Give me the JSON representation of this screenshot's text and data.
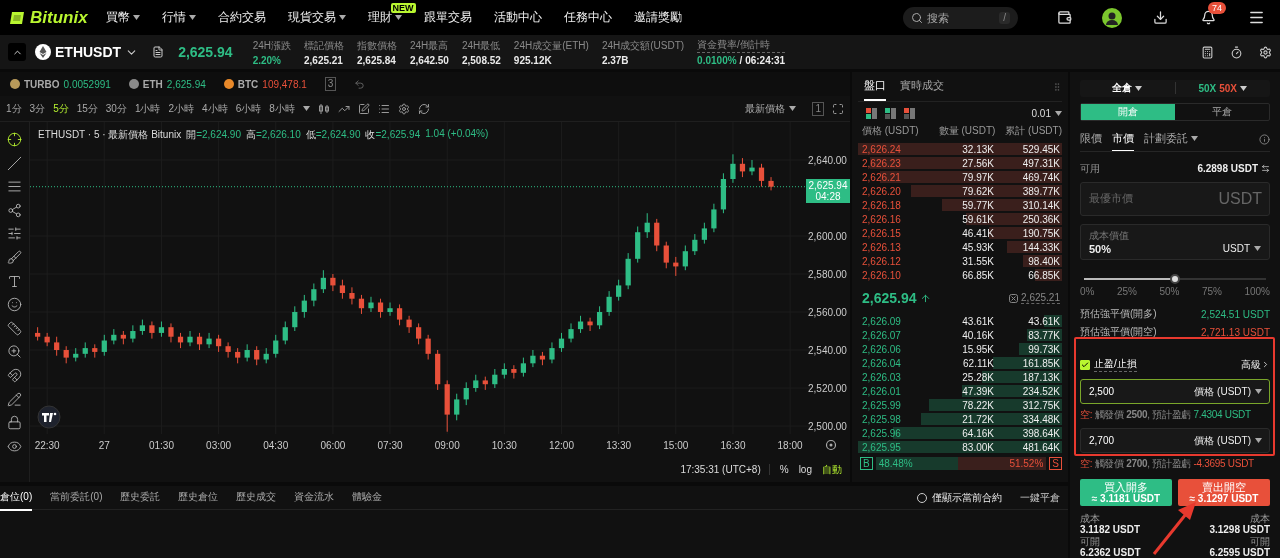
{
  "nav": {
    "logo": "Bitunix",
    "items": [
      {
        "label": "買幣",
        "dropdown": true
      },
      {
        "label": "行情",
        "dropdown": true
      },
      {
        "label": "合約交易",
        "dropdown": false
      },
      {
        "label": "現貨交易",
        "dropdown": true
      },
      {
        "label": "理財",
        "dropdown": true,
        "badge": "NEW"
      },
      {
        "label": "跟單交易",
        "dropdown": false
      },
      {
        "label": "活動中心",
        "dropdown": false
      },
      {
        "label": "任務中心",
        "dropdown": false
      },
      {
        "label": "邀請獎勵",
        "dropdown": false
      }
    ],
    "search": {
      "placeholder": "搜索",
      "shortcut": "/"
    },
    "notifications": "74"
  },
  "ticker": {
    "symbol": "ETHUSDT",
    "price": "2,625.94",
    "stats": [
      {
        "label": "24H漲跌",
        "value": "2.20%",
        "kind": "up"
      },
      {
        "label": "標記價格",
        "value": "2,625.21",
        "kind": "plain"
      },
      {
        "label": "指數價格",
        "value": "2,625.84",
        "kind": "plain"
      },
      {
        "label": "24H最高",
        "value": "2,642.50",
        "kind": "plain"
      },
      {
        "label": "24H最低",
        "value": "2,508.52",
        "kind": "plain"
      },
      {
        "label": "24H成交量(ETH)",
        "value": "925.12K",
        "kind": "plain"
      },
      {
        "label": "24H成交額(USDT)",
        "value": "2.37B",
        "kind": "plain"
      }
    ],
    "funding": {
      "label": "資金費率/倒計時",
      "rate": "0.0100%",
      "countdown": "/ 06:24:31"
    }
  },
  "watchlist": {
    "items": [
      {
        "symbol": "TURBO",
        "price": "0.0052991",
        "kind": "up",
        "color": "#b89a5a"
      },
      {
        "symbol": "ETH",
        "price": "2,625.94",
        "kind": "up",
        "color": "#8a8a8a"
      },
      {
        "symbol": "BTC",
        "price": "109,478.1",
        "kind": "down",
        "color": "#e8892a"
      }
    ],
    "layout_label": "3"
  },
  "chart": {
    "intervals": [
      {
        "label": "1分",
        "selected": false
      },
      {
        "label": "3分",
        "selected": false
      },
      {
        "label": "5分",
        "selected": true
      },
      {
        "label": "15分",
        "selected": false
      },
      {
        "label": "30分",
        "selected": false
      },
      {
        "label": "1小時",
        "selected": false
      },
      {
        "label": "2小時",
        "selected": false
      },
      {
        "label": "4小時",
        "selected": false
      },
      {
        "label": "6小時",
        "selected": false
      },
      {
        "label": "8小時",
        "selected": false
      }
    ],
    "price_type": "最新價格",
    "layout_label": "1",
    "legend": {
      "title": "ETHUSDT · 5 · 最新價格 Bitunix",
      "fields": [
        {
          "label": "開",
          "value": "=2,624.90"
        },
        {
          "label": "高",
          "value": "=2,626.10"
        },
        {
          "label": "低",
          "value": "=2,624.90"
        },
        {
          "label": "收",
          "value": "=2,625.94"
        }
      ],
      "change": "1.04 (+0.04%)"
    },
    "last_price": "2,625.94",
    "countdown": "04:28",
    "chart_data": {
      "type": "candlestick",
      "ylim": [
        2495.8,
        2660
      ],
      "grid": true,
      "ref_lines": [
        {
          "axis": "y",
          "value": 2625.94
        }
      ],
      "yticks": [
        {
          "value": 2640,
          "label": "2,640.00"
        },
        {
          "value": 2600,
          "label": "2,600.00"
        },
        {
          "value": 2580,
          "label": "2,580.00"
        },
        {
          "value": 2560,
          "label": "2,560.00"
        },
        {
          "value": 2540,
          "label": "2,540.00"
        },
        {
          "value": 2520,
          "label": "2,520.00"
        },
        {
          "value": 2500,
          "label": "2,500.00"
        }
      ],
      "categories": [
        null,
        "22:30",
        null,
        null,
        null,
        null,
        null,
        "27",
        null,
        null,
        null,
        null,
        null,
        "01:30",
        null,
        null,
        null,
        null,
        null,
        "03:00",
        null,
        null,
        null,
        null,
        null,
        "04:30",
        null,
        null,
        null,
        null,
        null,
        "06:00",
        null,
        null,
        null,
        null,
        null,
        "07:30",
        null,
        null,
        null,
        null,
        null,
        "09:00",
        null,
        null,
        null,
        null,
        null,
        "10:30",
        null,
        null,
        null,
        null,
        null,
        "12:00",
        null,
        null,
        null,
        null,
        null,
        "13:30",
        null,
        null,
        null,
        null,
        null,
        "15:00",
        null,
        null,
        null,
        null,
        null,
        "16:30",
        null,
        null,
        null,
        null,
        null,
        "18:00"
      ],
      "ohlc": [
        [
          2549,
          2552,
          2545,
          2547
        ],
        [
          2547,
          2549,
          2542,
          2544
        ],
        [
          2544,
          2547,
          2537,
          2540
        ],
        [
          2540,
          2542,
          2533,
          2536
        ],
        [
          2536,
          2541,
          2534,
          2538
        ],
        [
          2538,
          2544,
          2536,
          2541
        ],
        [
          2541,
          2543,
          2536,
          2539
        ],
        [
          2539,
          2548,
          2537,
          2545
        ],
        [
          2545,
          2551,
          2543,
          2548
        ],
        [
          2548,
          2550,
          2543,
          2546
        ],
        [
          2546,
          2553,
          2544,
          2550
        ],
        [
          2550,
          2556,
          2548,
          2553
        ],
        [
          2553,
          2555,
          2546,
          2549
        ],
        [
          2549,
          2555,
          2547,
          2552
        ],
        [
          2552,
          2554,
          2544,
          2547
        ],
        [
          2547,
          2549,
          2541,
          2544
        ],
        [
          2544,
          2550,
          2542,
          2547
        ],
        [
          2547,
          2549,
          2540,
          2543
        ],
        [
          2543,
          2549,
          2541,
          2546
        ],
        [
          2546,
          2548,
          2539,
          2542
        ],
        [
          2542,
          2544,
          2536,
          2539
        ],
        [
          2539,
          2541,
          2533,
          2536
        ],
        [
          2536,
          2543,
          2534,
          2540
        ],
        [
          2540,
          2542,
          2532,
          2535
        ],
        [
          2535,
          2541,
          2533,
          2538
        ],
        [
          2538,
          2548,
          2536,
          2545
        ],
        [
          2545,
          2555,
          2543,
          2552
        ],
        [
          2552,
          2563,
          2550,
          2560
        ],
        [
          2560,
          2569,
          2557,
          2566
        ],
        [
          2566,
          2575,
          2563,
          2572
        ],
        [
          2572,
          2582,
          2570,
          2578
        ],
        [
          2578,
          2580,
          2571,
          2574
        ],
        [
          2574,
          2577,
          2567,
          2570
        ],
        [
          2570,
          2573,
          2564,
          2567
        ],
        [
          2567,
          2569,
          2559,
          2562
        ],
        [
          2562,
          2568,
          2560,
          2565
        ],
        [
          2565,
          2567,
          2557,
          2560
        ],
        [
          2560,
          2565,
          2558,
          2562
        ],
        [
          2562,
          2564,
          2553,
          2556
        ],
        [
          2556,
          2558,
          2549,
          2552
        ],
        [
          2552,
          2554,
          2543,
          2546
        ],
        [
          2546,
          2548,
          2535,
          2538
        ],
        [
          2538,
          2540,
          2519,
          2522
        ],
        [
          2522,
          2524,
          2497,
          2506
        ],
        [
          2506,
          2517,
          2503,
          2514
        ],
        [
          2514,
          2523,
          2511,
          2520
        ],
        [
          2520,
          2527,
          2518,
          2524
        ],
        [
          2524,
          2526,
          2519,
          2522
        ],
        [
          2522,
          2530,
          2520,
          2527
        ],
        [
          2527,
          2533,
          2525,
          2530
        ],
        [
          2530,
          2532,
          2525,
          2528
        ],
        [
          2528,
          2536,
          2526,
          2533
        ],
        [
          2533,
          2540,
          2531,
          2537
        ],
        [
          2537,
          2539,
          2532,
          2535
        ],
        [
          2535,
          2544,
          2533,
          2541
        ],
        [
          2541,
          2549,
          2539,
          2546
        ],
        [
          2546,
          2554,
          2544,
          2551
        ],
        [
          2551,
          2558,
          2549,
          2555
        ],
        [
          2555,
          2557,
          2550,
          2553
        ],
        [
          2553,
          2563,
          2551,
          2560
        ],
        [
          2560,
          2571,
          2558,
          2568
        ],
        [
          2568,
          2577,
          2566,
          2574
        ],
        [
          2574,
          2591,
          2572,
          2588
        ],
        [
          2588,
          2605,
          2586,
          2602
        ],
        [
          2602,
          2612,
          2599,
          2607
        ],
        [
          2607,
          2609,
          2592,
          2595
        ],
        [
          2595,
          2597,
          2583,
          2586
        ],
        [
          2586,
          2589,
          2579,
          2584
        ],
        [
          2584,
          2595,
          2582,
          2592
        ],
        [
          2592,
          2601,
          2590,
          2598
        ],
        [
          2598,
          2607,
          2596,
          2604
        ],
        [
          2604,
          2617,
          2602,
          2614
        ],
        [
          2614,
          2633,
          2612,
          2630
        ],
        [
          2630,
          2643,
          2628,
          2638
        ],
        [
          2638,
          2641,
          2631,
          2634
        ],
        [
          2634,
          2640,
          2632,
          2636
        ],
        [
          2636,
          2638,
          2626,
          2629
        ],
        [
          2629,
          2631,
          2624,
          2625.94
        ],
        null,
        null
      ]
    },
    "clock": "17:35:31 (UTC+8)",
    "scale_buttons": [
      {
        "label": "%",
        "selected": false
      },
      {
        "label": "log",
        "selected": false
      },
      {
        "label": "自動",
        "selected": true
      }
    ]
  },
  "orderbook": {
    "tabs": [
      {
        "label": "盤口",
        "selected": true
      },
      {
        "label": "實時成交",
        "selected": false
      }
    ],
    "precision": "0.01",
    "columns": [
      "價格 (USDT)",
      "數量 (USDT)",
      "累計 (USDT)"
    ],
    "asks": [
      {
        "price": "2,626.24",
        "amount": "32.13K",
        "total": "529.45K",
        "level": 1.0
      },
      {
        "price": "2,626.23",
        "amount": "27.56K",
        "total": "497.31K",
        "level": 0.94
      },
      {
        "price": "2,626.21",
        "amount": "79.97K",
        "total": "469.74K",
        "level": 0.89
      },
      {
        "price": "2,626.20",
        "amount": "79.62K",
        "total": "389.77K",
        "level": 0.74
      },
      {
        "price": "2,626.18",
        "amount": "59.77K",
        "total": "310.14K",
        "level": 0.59
      },
      {
        "price": "2,626.16",
        "amount": "59.61K",
        "total": "250.36K",
        "level": 0.47
      },
      {
        "price": "2,626.15",
        "amount": "46.41K",
        "total": "190.75K",
        "level": 0.36
      },
      {
        "price": "2,626.13",
        "amount": "45.93K",
        "total": "144.33K",
        "level": 0.27
      },
      {
        "price": "2,626.12",
        "amount": "31.55K",
        "total": "98.40K",
        "level": 0.19
      },
      {
        "price": "2,626.10",
        "amount": "66.85K",
        "total": "66.85K",
        "level": 0.13
      }
    ],
    "mid": {
      "price": "2,625.94",
      "mark": "2,625.21"
    },
    "bids": [
      {
        "price": "2,626.09",
        "amount": "43.61K",
        "total": "43.61K",
        "level": 0.09
      },
      {
        "price": "2,626.07",
        "amount": "40.16K",
        "total": "83.77K",
        "level": 0.17
      },
      {
        "price": "2,626.06",
        "amount": "15.95K",
        "total": "99.73K",
        "level": 0.21
      },
      {
        "price": "2,626.04",
        "amount": "62.11K",
        "total": "161.85K",
        "level": 0.34
      },
      {
        "price": "2,626.03",
        "amount": "25.28K",
        "total": "187.13K",
        "level": 0.39
      },
      {
        "price": "2,626.01",
        "amount": "47.39K",
        "total": "234.52K",
        "level": 0.49
      },
      {
        "price": "2,625.99",
        "amount": "78.22K",
        "total": "312.75K",
        "level": 0.65
      },
      {
        "price": "2,625.98",
        "amount": "21.72K",
        "total": "334.48K",
        "level": 0.69
      },
      {
        "price": "2,625.96",
        "amount": "64.16K",
        "total": "398.64K",
        "level": 0.83
      },
      {
        "price": "2,625.95",
        "amount": "83.00K",
        "total": "481.64K",
        "level": 1.0
      }
    ],
    "ratio": {
      "buy_tag": "B",
      "buy": "48.48%",
      "sell": "51.52%",
      "sell_tag": "S",
      "level": 0.4848
    }
  },
  "order": {
    "margin_mode": "全倉",
    "leverage_long": "50X",
    "leverage_short": "50X",
    "sides": [
      {
        "label": "開倉",
        "selected": true
      },
      {
        "label": "平倉",
        "selected": false
      }
    ],
    "types": [
      {
        "label": "限價",
        "selected": false,
        "dropdown": false
      },
      {
        "label": "市價",
        "selected": true,
        "dropdown": false
      },
      {
        "label": "計劃委託",
        "selected": false,
        "dropdown": true
      }
    ],
    "available_label": "可用",
    "available": "6.2898 USDT",
    "price_field": {
      "placeholder": "最優市價",
      "unit": "USDT"
    },
    "cost_field": {
      "label": "成本價值",
      "value": "50%",
      "unit": "USDT"
    },
    "slider": {
      "level": 0.5,
      "marks": [
        "0%",
        "25%",
        "50%",
        "75%",
        "100%"
      ]
    },
    "liquidation": [
      {
        "label": "預估強平價(開多)",
        "value": "2,524.51 USDT",
        "kind": "up"
      },
      {
        "label": "預估強平價(開空)",
        "value": "2,721.13 USDT",
        "kind": "down"
      }
    ],
    "tpsl": {
      "label": "止盈/止損",
      "checked": true,
      "advanced": "高級",
      "fields": [
        {
          "value": "2,500",
          "unit": "價格 (USDT)",
          "focused": true,
          "hint": {
            "side": "空:",
            "text": "觸發價 **2500**, 預計盈虧",
            "pnl": "7.4304 USDT",
            "kind": "up"
          }
        },
        {
          "value": "2,700",
          "unit": "價格 (USDT)",
          "focused": false,
          "hint": {
            "side": "空:",
            "text": "觸發價 **2700**, 預計盈虧",
            "pnl": "-4.3695 USDT",
            "kind": "down"
          }
        }
      ]
    },
    "buttons": [
      {
        "label": "買入開多",
        "amount": "≈ 3.1181 USDT",
        "kind": "buy"
      },
      {
        "label": "賣出開空",
        "amount": "≈ 3.1297 USDT",
        "kind": "sell"
      }
    ],
    "summary": [
      {
        "cost_label": "成本",
        "cost": "3.1182 USDT",
        "max_label": "可開",
        "max": "6.2362 USDT"
      },
      {
        "cost_label": "成本",
        "cost": "3.1298 USDT",
        "max_label": "可開",
        "max": "6.2595 USDT"
      }
    ]
  },
  "positions": {
    "tabs": [
      {
        "label": "倉位(0)",
        "selected": true
      },
      {
        "label": "當前委託(0)",
        "selected": false
      },
      {
        "label": "歷史委託",
        "selected": false
      },
      {
        "label": "歷史倉位",
        "selected": false
      },
      {
        "label": "歷史成交",
        "selected": false
      },
      {
        "label": "資金流水",
        "selected": false
      },
      {
        "label": "體驗金",
        "selected": false
      }
    ],
    "filter": {
      "label": "僅顯示當前合約",
      "checked": false
    },
    "close_all": "一鍵平倉"
  }
}
